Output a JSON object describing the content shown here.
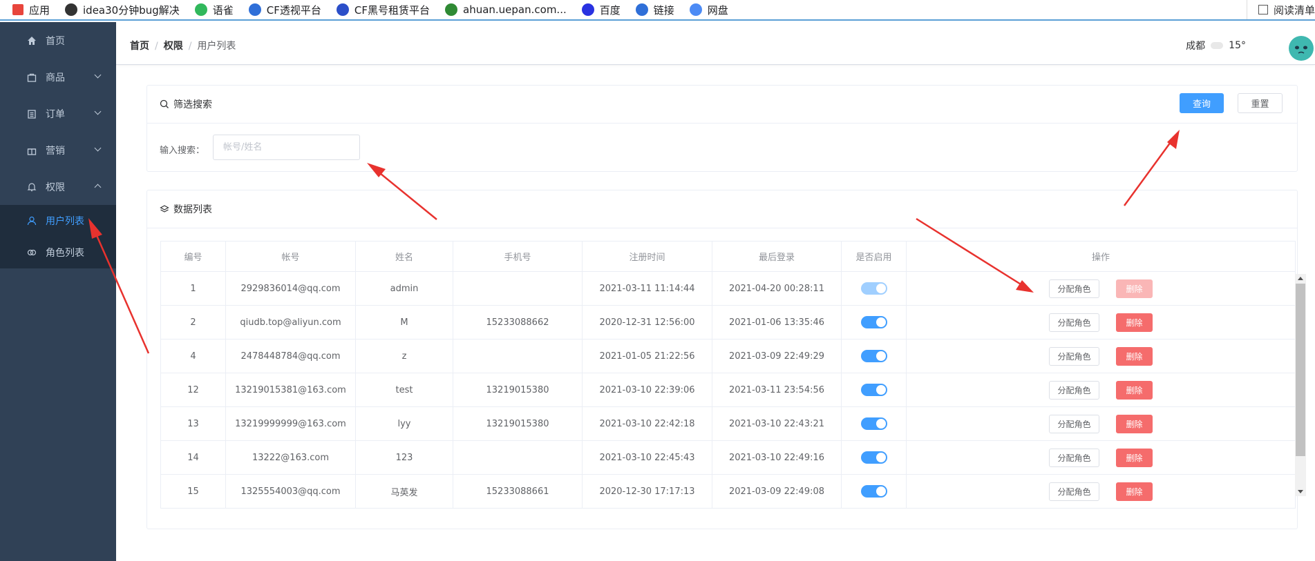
{
  "bookmarks": [
    {
      "label": "应用",
      "color": "#e8453c"
    },
    {
      "label": "idea30分钟bug解决",
      "color": "#333333"
    },
    {
      "label": "语雀",
      "color": "#31b85c"
    },
    {
      "label": "CF透视平台",
      "color": "#2f6fd8"
    },
    {
      "label": "CF黑号租赁平台",
      "color": "#2b4fc9"
    },
    {
      "label": "ahuan.uepan.com...",
      "color": "#2f8a34"
    },
    {
      "label": "百度",
      "color": "#2932e1"
    },
    {
      "label": "链接",
      "color": "#2f6fd8"
    },
    {
      "label": "网盘",
      "color": "#4c8bf5"
    }
  ],
  "reading_list": "阅读清单",
  "sidebar": {
    "items": [
      {
        "label": "首页"
      },
      {
        "label": "商品"
      },
      {
        "label": "订单"
      },
      {
        "label": "营销"
      },
      {
        "label": "权限"
      }
    ],
    "sub_items": [
      {
        "label": "用户列表"
      },
      {
        "label": "角色列表"
      }
    ]
  },
  "header": {
    "breadcrumb": [
      "首页",
      "权限",
      "用户列表"
    ],
    "city": "成都",
    "temperature": "15°"
  },
  "filter": {
    "title": "筛选搜索",
    "query_label": "查询",
    "reset_label": "重置",
    "search_label": "输入搜索：",
    "search_placeholder": "帐号/姓名"
  },
  "list": {
    "title": "数据列表",
    "columns": [
      "编号",
      "帐号",
      "姓名",
      "手机号",
      "注册时间",
      "最后登录",
      "是否启用",
      "操作"
    ],
    "assign_label": "分配角色",
    "delete_label": "删除",
    "rows": [
      {
        "id": "1",
        "account": "2929836014@qq.com",
        "name": "admin",
        "phone": "",
        "registered": "2021-03-11 11:14:44",
        "last_login": "2021-04-20 00:28:11",
        "enabled": true,
        "disabled_ops": true
      },
      {
        "id": "2",
        "account": "qiudb.top@aliyun.com",
        "name": "M",
        "phone": "15233088662",
        "registered": "2020-12-31 12:56:00",
        "last_login": "2021-01-06 13:35:46",
        "enabled": true,
        "disabled_ops": false
      },
      {
        "id": "4",
        "account": "2478448784@qq.com",
        "name": "z",
        "phone": "",
        "registered": "2021-01-05 21:22:56",
        "last_login": "2021-03-09 22:49:29",
        "enabled": true,
        "disabled_ops": false
      },
      {
        "id": "12",
        "account": "13219015381@163.com",
        "name": "test",
        "phone": "13219015380",
        "registered": "2021-03-10 22:39:06",
        "last_login": "2021-03-11 23:54:56",
        "enabled": true,
        "disabled_ops": false
      },
      {
        "id": "13",
        "account": "13219999999@163.com",
        "name": "lyy",
        "phone": "13219015380",
        "registered": "2021-03-10 22:42:18",
        "last_login": "2021-03-10 22:43:21",
        "enabled": true,
        "disabled_ops": false
      },
      {
        "id": "14",
        "account": "13222@163.com",
        "name": "123",
        "phone": "",
        "registered": "2021-03-10 22:45:43",
        "last_login": "2021-03-10 22:49:16",
        "enabled": true,
        "disabled_ops": false
      },
      {
        "id": "15",
        "account": "1325554003@qq.com",
        "name": "马英发",
        "phone": "15233088661",
        "registered": "2020-12-30 17:17:13",
        "last_login": "2021-03-09 22:49:08",
        "enabled": true,
        "disabled_ops": false
      }
    ]
  },
  "colors": {
    "sidebar": "#304156",
    "primary": "#409eff",
    "danger": "#f56c6c",
    "annotation": "#e8322e"
  }
}
